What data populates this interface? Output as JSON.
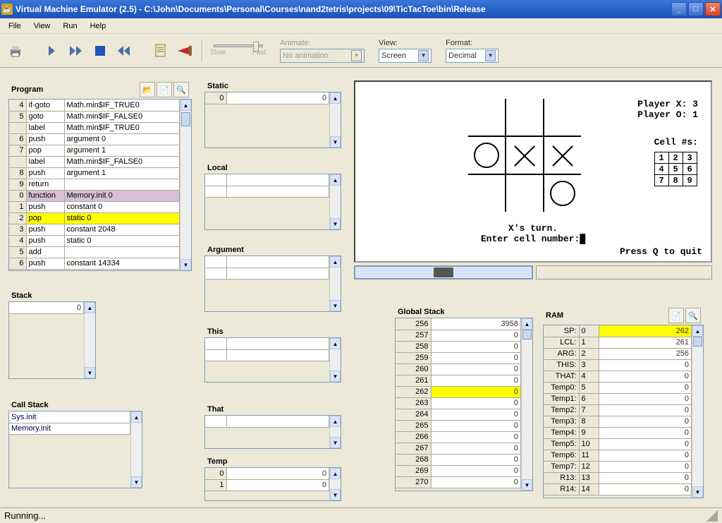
{
  "window": {
    "title": "Virtual Machine Emulator (2.5) - C:\\John\\Documents\\Personal\\Courses\\nand2tetris\\projects\\09\\TicTacToe\\bin\\Release"
  },
  "menu": [
    "File",
    "View",
    "Run",
    "Help"
  ],
  "toolbar": {
    "animate_label": "Animate:",
    "animate_value": "No animation",
    "view_label": "View:",
    "view_value": "Screen",
    "format_label": "Format:",
    "format_value": "Decimal",
    "slow": "Slow",
    "fast": "Fast"
  },
  "program": {
    "title": "Program",
    "rows": [
      {
        "n": "4",
        "op": "if-goto",
        "arg": "Math.min$IF_TRUE0"
      },
      {
        "n": "5",
        "op": "goto",
        "arg": "Math.min$IF_FALSE0"
      },
      {
        "n": "",
        "op": "label",
        "arg": "Math.min$IF_TRUE0"
      },
      {
        "n": "6",
        "op": "push",
        "arg": "argument 0"
      },
      {
        "n": "7",
        "op": "pop",
        "arg": "argument 1"
      },
      {
        "n": "",
        "op": "label",
        "arg": "Math.min$IF_FALSE0"
      },
      {
        "n": "8",
        "op": "push",
        "arg": "argument 1"
      },
      {
        "n": "9",
        "op": "return",
        "arg": ""
      },
      {
        "n": "0",
        "op": "function",
        "arg": "Memory.init 0",
        "hl": "purple"
      },
      {
        "n": "1",
        "op": "push",
        "arg": "constant 0"
      },
      {
        "n": "2",
        "op": "pop",
        "arg": "static 0",
        "hl": "yellow"
      },
      {
        "n": "3",
        "op": "push",
        "arg": "constant 2048"
      },
      {
        "n": "4",
        "op": "push",
        "arg": "static 0"
      },
      {
        "n": "5",
        "op": "add",
        "arg": ""
      },
      {
        "n": "6",
        "op": "push",
        "arg": "constant 14334"
      }
    ]
  },
  "stack": {
    "title": "Stack",
    "rows": [
      {
        "v": "0"
      }
    ]
  },
  "callstack": {
    "title": "Call Stack",
    "rows": [
      "Sys.init",
      "Memory.init"
    ]
  },
  "segments": {
    "static": {
      "title": "Static",
      "rows": [
        {
          "i": "0",
          "v": "0"
        }
      ]
    },
    "local": {
      "title": "Local"
    },
    "argument": {
      "title": "Argument"
    },
    "this": {
      "title": "This"
    },
    "that": {
      "title": "That"
    },
    "temp": {
      "title": "Temp",
      "rows": [
        {
          "i": "0",
          "v": "0"
        },
        {
          "i": "1",
          "v": "0"
        }
      ]
    }
  },
  "globalstack": {
    "title": "Global Stack",
    "rows": [
      {
        "i": "256",
        "v": "3958"
      },
      {
        "i": "257",
        "v": "0"
      },
      {
        "i": "258",
        "v": "0"
      },
      {
        "i": "259",
        "v": "0"
      },
      {
        "i": "260",
        "v": "0"
      },
      {
        "i": "261",
        "v": "0"
      },
      {
        "i": "262",
        "v": "0",
        "hl": "yellow"
      },
      {
        "i": "263",
        "v": "0"
      },
      {
        "i": "264",
        "v": "0"
      },
      {
        "i": "265",
        "v": "0"
      },
      {
        "i": "266",
        "v": "0"
      },
      {
        "i": "267",
        "v": "0"
      },
      {
        "i": "268",
        "v": "0"
      },
      {
        "i": "269",
        "v": "0"
      },
      {
        "i": "270",
        "v": "0"
      }
    ]
  },
  "ram": {
    "title": "RAM",
    "rows": [
      {
        "n": "SP:",
        "i": "0",
        "v": "262",
        "hl": "yellow"
      },
      {
        "n": "LCL:",
        "i": "1",
        "v": "261"
      },
      {
        "n": "ARG:",
        "i": "2",
        "v": "256"
      },
      {
        "n": "THIS:",
        "i": "3",
        "v": "0"
      },
      {
        "n": "THAT:",
        "i": "4",
        "v": "0"
      },
      {
        "n": "Temp0:",
        "i": "5",
        "v": "0"
      },
      {
        "n": "Temp1:",
        "i": "6",
        "v": "0"
      },
      {
        "n": "Temp2:",
        "i": "7",
        "v": "0"
      },
      {
        "n": "Temp3:",
        "i": "8",
        "v": "0"
      },
      {
        "n": "Temp4:",
        "i": "9",
        "v": "0"
      },
      {
        "n": "Temp5:",
        "i": "10",
        "v": "0"
      },
      {
        "n": "Temp6:",
        "i": "11",
        "v": "0"
      },
      {
        "n": "Temp7:",
        "i": "12",
        "v": "0"
      },
      {
        "n": "R13:",
        "i": "13",
        "v": "0"
      },
      {
        "n": "R14:",
        "i": "14",
        "v": "0"
      }
    ]
  },
  "screen": {
    "score_x": "Player X: 3",
    "score_o": "Player O: 1",
    "cell_label": "Cell #s:",
    "cells": [
      "1",
      "2",
      "3",
      "4",
      "5",
      "6",
      "7",
      "8",
      "9"
    ],
    "turn": "X's turn.",
    "prompt": "Enter cell number:",
    "quit": "Press Q to quit"
  },
  "status": "Running..."
}
